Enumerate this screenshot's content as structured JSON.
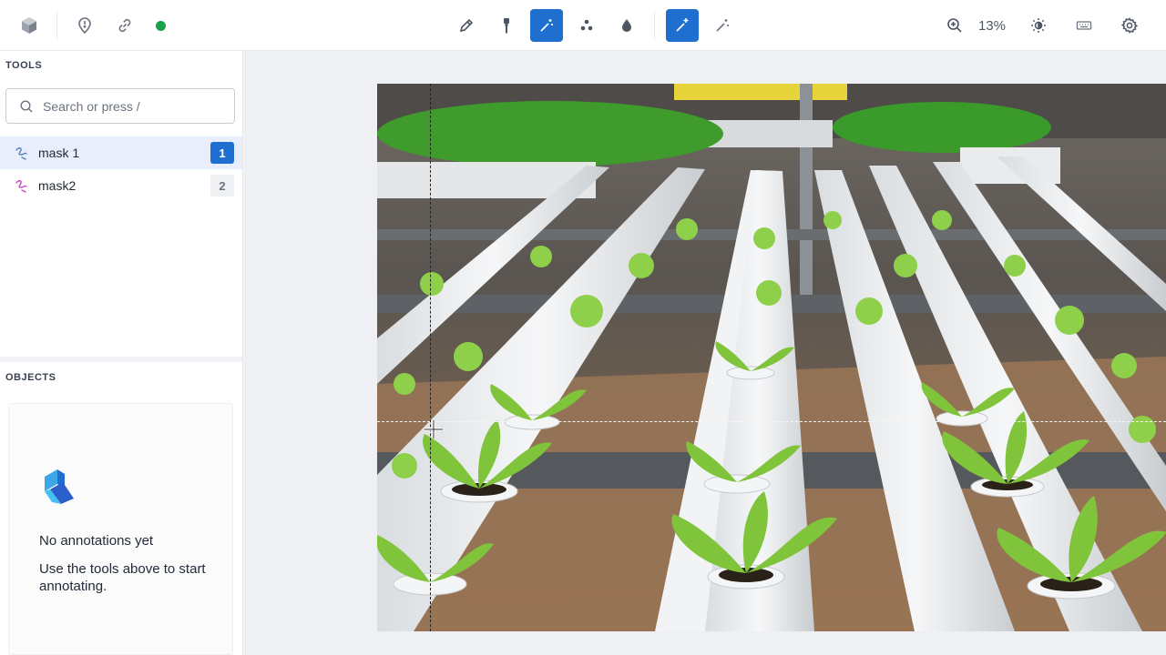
{
  "toolbar": {
    "left": [
      {
        "name": "app-logo-icon"
      },
      {
        "name": "location-pin-icon"
      },
      {
        "name": "link-icon"
      },
      {
        "name": "status-dot-icon"
      }
    ],
    "center": [
      {
        "name": "pencil-icon",
        "active": false
      },
      {
        "name": "brush-icon",
        "active": false
      },
      {
        "name": "magic-wand-icon",
        "active": true
      },
      {
        "name": "points-icon",
        "active": false
      },
      {
        "name": "drop-icon",
        "active": false
      },
      {
        "name": "magic-wand-plus-icon",
        "active": true
      },
      {
        "name": "magic-wand-outline-icon",
        "active": false
      }
    ],
    "zoom_level": "13%",
    "right": [
      {
        "name": "zoom-in-icon"
      },
      {
        "name": "brightness-icon"
      },
      {
        "name": "keyboard-icon"
      },
      {
        "name": "settings-gear-icon"
      }
    ]
  },
  "sidebar": {
    "tools_label": "TOOLS",
    "search": {
      "placeholder": "Search or press /"
    },
    "tools": [
      {
        "label": "mask 1",
        "badge": "1",
        "selected": true,
        "color": "#5b7fb5"
      },
      {
        "label": "mask2",
        "badge": "2",
        "selected": false,
        "color": "#c64cc0"
      }
    ],
    "objects_label": "OBJECTS",
    "empty_state": {
      "title": "No annotations yet",
      "description": "Use the tools above to start annotating."
    }
  },
  "colors": {
    "accent": "#1f6fd1",
    "status_green": "#16a34a",
    "mask1": "#5b7fb5",
    "mask2": "#c64cc0"
  }
}
